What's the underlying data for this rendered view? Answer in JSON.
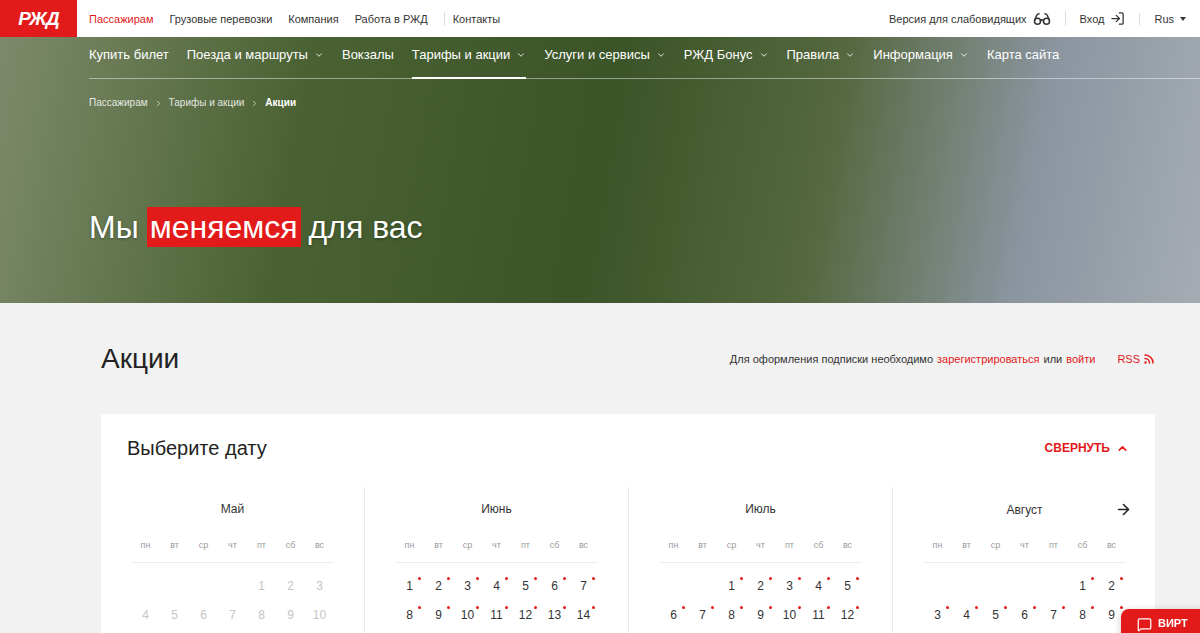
{
  "top_bar": {
    "logo": "РЖД",
    "links": [
      {
        "label": "Пассажирам",
        "selected": true
      },
      {
        "label": "Грузовые перевозки",
        "selected": false
      },
      {
        "label": "Компания",
        "selected": false
      },
      {
        "label": "Работа в РЖД",
        "selected": false
      },
      {
        "label": "Контакты",
        "selected": false
      }
    ],
    "accessibility": "Версия для слабовидящих",
    "login": "Вход",
    "language": "Rus"
  },
  "main_menu": [
    {
      "label": "Купить билет",
      "selected": false,
      "has_submenu": false
    },
    {
      "label": "Поезда и маршруты",
      "selected": false,
      "has_submenu": true
    },
    {
      "label": "Вокзалы",
      "selected": false,
      "has_submenu": false
    },
    {
      "label": "Тарифы и акции",
      "selected": true,
      "has_submenu": true
    },
    {
      "label": "Услуги и сервисы",
      "selected": false,
      "has_submenu": true
    },
    {
      "label": "РЖД Бонус",
      "selected": false,
      "has_submenu": true
    },
    {
      "label": "Правила",
      "selected": false,
      "has_submenu": true
    },
    {
      "label": "Информация",
      "selected": false,
      "has_submenu": true
    },
    {
      "label": "Карта сайта",
      "selected": false,
      "has_submenu": false
    }
  ],
  "breadcrumbs": [
    {
      "label": "Пассажирам",
      "selected": false
    },
    {
      "label": "Тарифы и акции",
      "selected": false
    },
    {
      "label": "Акции",
      "selected": true
    }
  ],
  "hero": {
    "title_before": "Мы",
    "title_highlight": "меняемся",
    "title_after": "для вас"
  },
  "section": {
    "title": "Акции",
    "subscribe_text": "Для оформления подписки необходимо",
    "register_link": "зарегистрироваться",
    "or": "или",
    "login_link": "войти",
    "rss": "RSS"
  },
  "date_picker": {
    "title": "Выберите дату",
    "collapse": "СВЕРНУТЬ",
    "expanded": true,
    "weekdays": [
      "пн",
      "вт",
      "ср",
      "чт",
      "пт",
      "сб",
      "вс"
    ],
    "months": [
      {
        "name": "Май",
        "weeks": [
          [
            {
              "day": "",
              "past": false,
              "event": false
            },
            {
              "day": "",
              "past": false,
              "event": false
            },
            {
              "day": "",
              "past": false,
              "event": false
            },
            {
              "day": "",
              "past": false,
              "event": false
            },
            {
              "day": "1",
              "past": true,
              "event": false
            },
            {
              "day": "2",
              "past": true,
              "event": false
            },
            {
              "day": "3",
              "past": true,
              "event": false
            }
          ],
          [
            {
              "day": "4",
              "past": true,
              "event": false
            },
            {
              "day": "5",
              "past": true,
              "event": false
            },
            {
              "day": "6",
              "past": true,
              "event": false
            },
            {
              "day": "7",
              "past": true,
              "event": false
            },
            {
              "day": "8",
              "past": true,
              "event": false
            },
            {
              "day": "9",
              "past": true,
              "event": false
            },
            {
              "day": "10",
              "past": true,
              "event": false
            }
          ]
        ]
      },
      {
        "name": "Июнь",
        "weeks": [
          [
            {
              "day": "1",
              "past": false,
              "event": true
            },
            {
              "day": "2",
              "past": false,
              "event": true
            },
            {
              "day": "3",
              "past": false,
              "event": true
            },
            {
              "day": "4",
              "past": false,
              "event": true
            },
            {
              "day": "5",
              "past": false,
              "event": true
            },
            {
              "day": "6",
              "past": false,
              "event": true
            },
            {
              "day": "7",
              "past": false,
              "event": true
            }
          ],
          [
            {
              "day": "8",
              "past": false,
              "event": true
            },
            {
              "day": "9",
              "past": false,
              "event": true
            },
            {
              "day": "10",
              "past": false,
              "event": true
            },
            {
              "day": "11",
              "past": false,
              "event": true
            },
            {
              "day": "12",
              "past": false,
              "event": true
            },
            {
              "day": "13",
              "past": false,
              "event": true
            },
            {
              "day": "14",
              "past": false,
              "event": true
            }
          ]
        ]
      },
      {
        "name": "Июль",
        "weeks": [
          [
            {
              "day": "",
              "past": false,
              "event": false
            },
            {
              "day": "",
              "past": false,
              "event": false
            },
            {
              "day": "1",
              "past": false,
              "event": true
            },
            {
              "day": "2",
              "past": false,
              "event": true
            },
            {
              "day": "3",
              "past": false,
              "event": true
            },
            {
              "day": "4",
              "past": false,
              "event": true
            },
            {
              "day": "5",
              "past": false,
              "event": true
            }
          ],
          [
            {
              "day": "6",
              "past": false,
              "event": true
            },
            {
              "day": "7",
              "past": false,
              "event": true
            },
            {
              "day": "8",
              "past": false,
              "event": true
            },
            {
              "day": "9",
              "past": false,
              "event": true
            },
            {
              "day": "10",
              "past": false,
              "event": true
            },
            {
              "day": "11",
              "past": false,
              "event": true
            },
            {
              "day": "12",
              "past": false,
              "event": true
            }
          ]
        ]
      },
      {
        "name": "Август",
        "weeks": [
          [
            {
              "day": "",
              "past": false,
              "event": false
            },
            {
              "day": "",
              "past": false,
              "event": false
            },
            {
              "day": "",
              "past": false,
              "event": false
            },
            {
              "day": "",
              "past": false,
              "event": false
            },
            {
              "day": "",
              "past": false,
              "event": false
            },
            {
              "day": "1",
              "past": false,
              "event": true
            },
            {
              "day": "2",
              "past": false,
              "event": true
            }
          ],
          [
            {
              "day": "3",
              "past": false,
              "event": true
            },
            {
              "day": "4",
              "past": false,
              "event": true
            },
            {
              "day": "5",
              "past": false,
              "event": true
            },
            {
              "day": "6",
              "past": false,
              "event": true
            },
            {
              "day": "7",
              "past": false,
              "event": true
            },
            {
              "day": "8",
              "past": false,
              "event": true
            },
            {
              "day": "9",
              "past": false,
              "event": true
            }
          ]
        ]
      }
    ]
  },
  "assistant_button": {
    "label": "ВИРТ"
  }
}
